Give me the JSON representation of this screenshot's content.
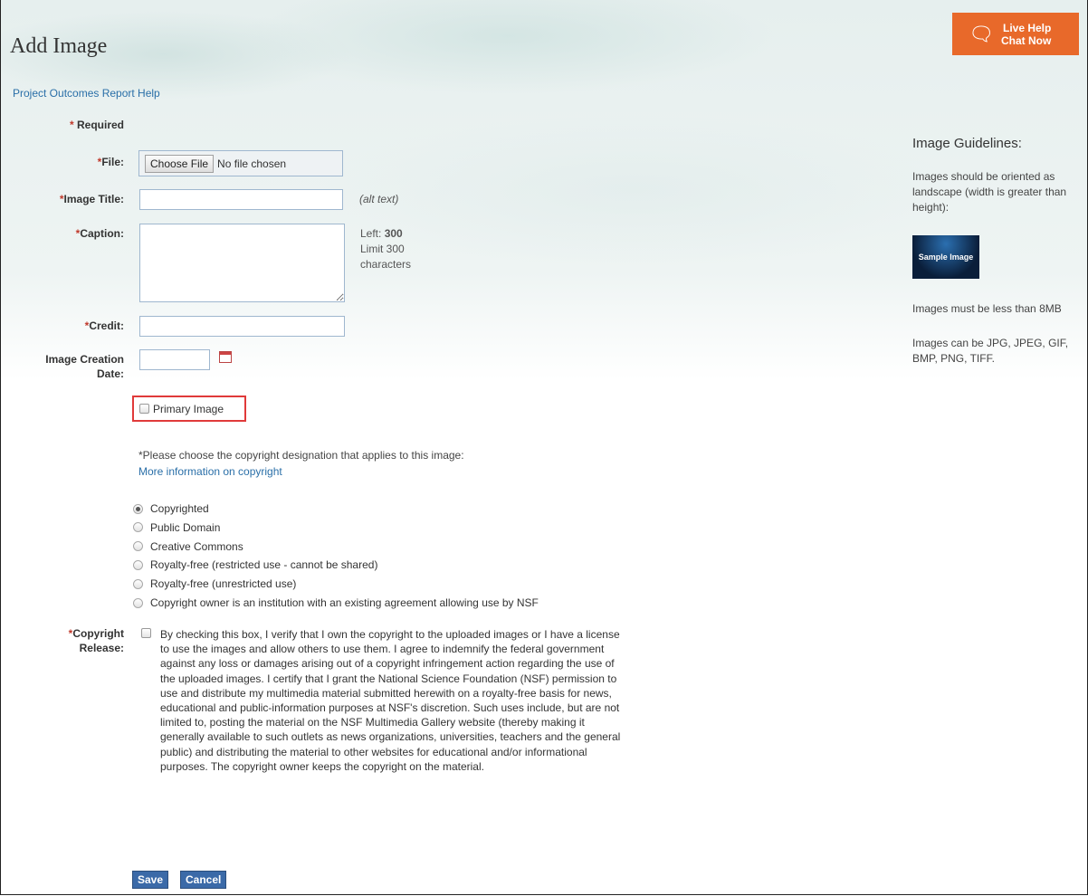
{
  "header": {
    "title": "Add Image",
    "help_link": "Project Outcomes Report Help",
    "live_help_line1": "Live Help",
    "live_help_line2": "Chat Now"
  },
  "form": {
    "required_mark": "*",
    "required_label": "Required",
    "file_label": "File:",
    "choose_file_button": "Choose File",
    "no_file_text": "No file chosen",
    "image_title_label": "Image Title:",
    "image_title_value": "",
    "alt_text_note": "(alt text)",
    "caption_label": "Caption:",
    "caption_value": "",
    "left_prefix": "Left:",
    "left_count": "300",
    "limit_line1": "Limit 300",
    "limit_line2": "characters",
    "credit_label": "Credit:",
    "credit_value": "",
    "creation_date_line1": "Image Creation",
    "creation_date_line2": "Date:",
    "creation_date_value": "",
    "primary_image_label": "Primary Image",
    "copyright_prompt": "*Please choose the copyright designation that applies to this image:",
    "copyright_info_link": "More information on copyright",
    "copyright_options": [
      {
        "label": "Copyrighted",
        "selected": true
      },
      {
        "label": "Public Domain",
        "selected": false
      },
      {
        "label": "Creative Commons",
        "selected": false
      },
      {
        "label": "Royalty-free (restricted use - cannot be shared)",
        "selected": false
      },
      {
        "label": "Royalty-free (unrestricted use)",
        "selected": false
      },
      {
        "label": "Copyright owner is an institution with an existing agreement allowing use by NSF",
        "selected": false
      }
    ],
    "copyright_release_line1": "Copyright",
    "copyright_release_line2": "Release:",
    "copyright_release_text": "By checking this box, I verify that I own the copyright to the uploaded images or I have a license to use the images and allow others to use them. I agree to indemnify the federal government against any loss or damages arising out of a copyright infringement action regarding the use of the uploaded images.  I certify that I grant the National Science Foundation (NSF) permission to use and distribute my multimedia material submitted herewith on a royalty-free basis for news, educational and public-information purposes at NSF's discretion.  Such uses include, but are not limited to, posting the material on the NSF Multimedia Gallery website (thereby making it generally available to such outlets as news organizations, universities, teachers and the general public) and distributing the material to other websites for educational and/or informational purposes.  The copyright owner keeps the copyright on the material.",
    "save_button": "Save",
    "cancel_button": "Cancel"
  },
  "guidelines": {
    "heading": "Image Guidelines:",
    "orientation_text": "Images should be oriented as landscape (width is greater than height):",
    "sample_image_text": "Sample Image",
    "size_text": "Images must be less than 8MB",
    "formats_text": "Images can be JPG, JPEG, GIF, BMP, PNG, TIFF."
  },
  "colors": {
    "accent_orange": "#e8692a",
    "link_blue": "#2a6fa8",
    "button_blue": "#3b6aa8",
    "required_red": "#c0392b",
    "highlight_red": "#e03a3a"
  }
}
